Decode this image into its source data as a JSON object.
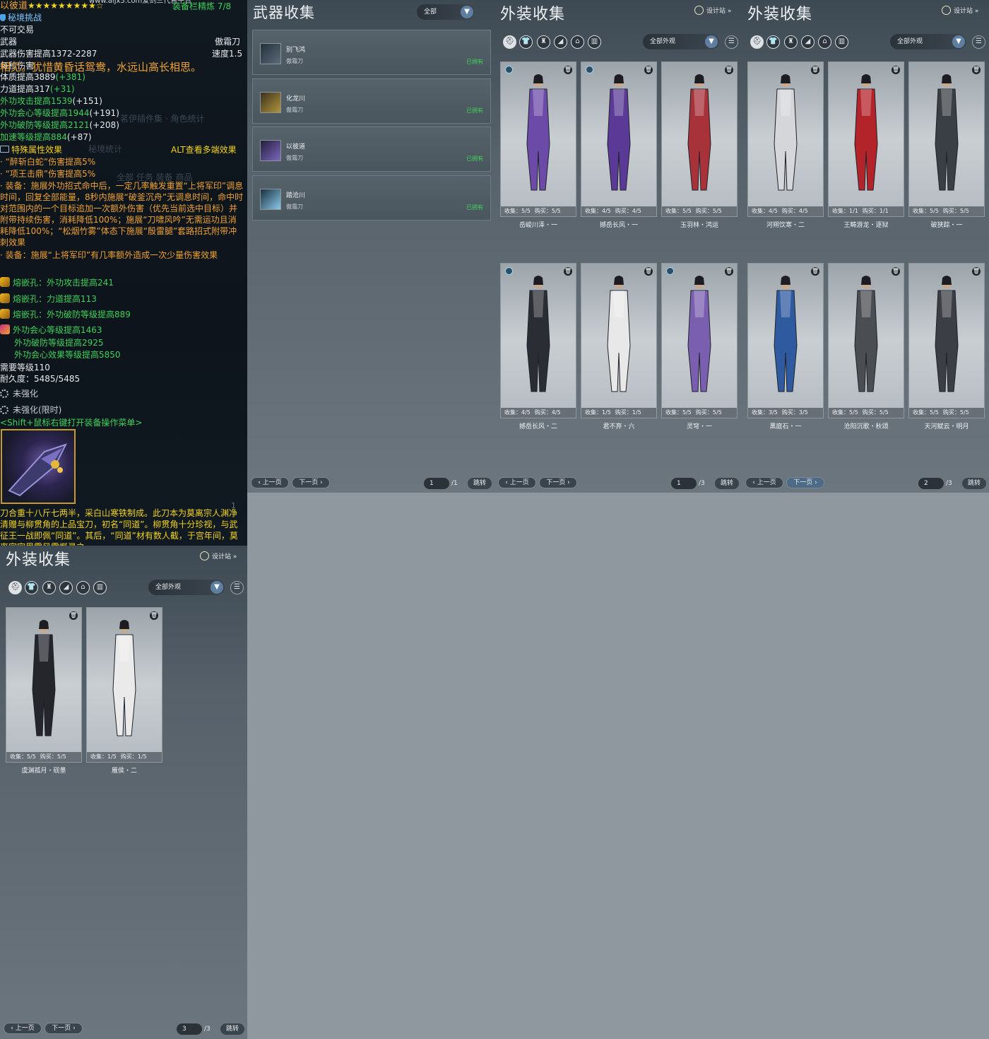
{
  "tooltip": {
    "name": "以彼道",
    "stars": "★★★★★★★★★☆",
    "refine": "装备栏精炼 7/8",
    "watermark": "www.aijx5.com爱剑三代售平台",
    "source": "秘境挑战",
    "trade": "不可交易",
    "slot": "武器",
    "type": "傲霜刀",
    "damage": "武器伤害提高1372-2287",
    "speed": "速度1.5",
    "overlay_poem": "相见。犹惜黄昏话鸳鸯，水远山高长相思。",
    "dps": "每秒伤害",
    "attr1": "体质提高3889",
    "attr1_bonus": "(+381)",
    "attr2": "力道提高317",
    "attr2_bonus": "(+31)",
    "attr3": "外功攻击提高1539",
    "attr3_bonus": "(+151)",
    "attr4": "外功会心等级提高1944",
    "attr4_bonus": "(+191)",
    "attr5": "外功破防等级提高2121",
    "attr5_bonus": "(+208)",
    "attr6": "加速等级提高884",
    "attr6_bonus": "(+87)",
    "bg_text1": "茗伊插件集 · 角色统计",
    "bg_text2": "秘境统计",
    "bg_text3": "全部    任务    装备    商品",
    "special_label": "特殊属性效果",
    "alt_hint": "ALT查看多端效果",
    "effect1": "· “醉斩白蛇”伤害提高5%",
    "effect2": "· “项王击鼎”伤害提高5%",
    "effect3": "· 装备：施展外功招式命中后，一定几率触发重置“上将军印”调息时间，回复全部能量，8秒内施展“破釜沉舟”无调息时间，命中时对范围内的一个目标追加一次额外伤害（优先当前选中目标）并附带持续伤害，消耗降低100%；施展“刀啸风吟”无需运功且消耗降低100%；“松烟竹雾”体态下施展“殷雷腿”套路招式附带冲刺效果",
    "effect4": "· 装备：施展“上将军印”有几率额外造成一次少量伤害效果",
    "gem1": "熔嵌孔：外功攻击提高241",
    "gem2": "熔嵌孔：力道提高113",
    "gem3": "熔嵌孔：外功破防等级提高889",
    "enchant1": "外功会心等级提高1463",
    "enchant2": "外功破防等级提高2925",
    "enchant3": "外功会心效果等级提高5850",
    "req_level": "需要等级110",
    "durability": "耐久度：5485/5485",
    "unenhanced1": "未强化",
    "unenhanced2": "未强化(限时)",
    "shift_hint": "<Shift+鼠标右键打开装备操作菜单>",
    "desc_count": "1",
    "desc": "刀合重十八斤七两半，采白山寒铁制成。此刀本为莫离宗人渊净清赠与柳贯角的上品宝刀，初名“同道”。柳贯角十分珍视，与武征王一战即佩“同道”。其后，“同道”材有数人截，于宫年间，莫离宗宗里雷风雷慨录之"
  },
  "weapon_panel": {
    "title": "武器收集",
    "filter": "全部",
    "items": [
      {
        "name": "别飞鸿",
        "sub": "傲霜刀",
        "owned": "已拥有"
      },
      {
        "name": "化龙川",
        "sub": "傲霜刀",
        "owned": "已拥有"
      },
      {
        "name": "以彼道",
        "sub": "傲霜刀",
        "owned": "已拥有"
      },
      {
        "name": "踏沧川",
        "sub": "傲霜刀",
        "owned": "已拥有"
      }
    ],
    "prev": "上一页",
    "next": "下一页",
    "page": "1",
    "total": "/1",
    "jump": "跳转"
  },
  "outfit_common": {
    "title": "外装收集",
    "designer": "设计站",
    "filter": "全部外观",
    "prev": "上一页",
    "next": "下一页",
    "jump": "跳转",
    "cat_icons": [
      "head-icon",
      "top-icon",
      "waist-icon",
      "cloak-icon",
      "hat-icon",
      "pants-icon"
    ]
  },
  "outfit_p1": {
    "page": "1",
    "total": "/3",
    "cards": [
      {
        "collect": "收集：5/5",
        "buy": "购买：5/5",
        "name": "岳峻川泽・一",
        "badge": true,
        "color": "#6c4aa8"
      },
      {
        "collect": "收集：4/5",
        "buy": "购买：4/5",
        "name": "撼岳长风・一",
        "badge": true,
        "color": "#5a3a96"
      },
      {
        "collect": "收集：5/5",
        "buy": "购买：5/5",
        "name": "玉羽林・鸿运",
        "badge": false,
        "color": "#a8323a"
      },
      {
        "collect": "收集：4/5",
        "buy": "购买：4/5",
        "name": "撼岳长风・二",
        "badge": true,
        "color": "#2a2d34"
      },
      {
        "collect": "收集：1/5",
        "buy": "购买：1/5",
        "name": "君不弃・六",
        "badge": false,
        "color": "#e8e8e8"
      },
      {
        "collect": "收集：5/5",
        "buy": "购买：5/5",
        "name": "灵穹・一",
        "badge": true,
        "color": "#7a5fb0"
      }
    ]
  },
  "outfit_p2": {
    "page": "2",
    "total": "/3",
    "cards": [
      {
        "collect": "收集：4/5",
        "buy": "购买：4/5",
        "name": "河朔饮寒・二",
        "badge": false,
        "color": "#d4d6da"
      },
      {
        "collect": "收集：1/1",
        "buy": "购买：1/1",
        "name": "王畴游龙・逐狱",
        "badge": false,
        "color": "#b3232a"
      },
      {
        "collect": "收集：5/5",
        "buy": "购买：5/5",
        "name": "破狭踪・一",
        "badge": false,
        "color": "#3a3f46"
      },
      {
        "collect": "收集：3/5",
        "buy": "购买：3/5",
        "name": "黑庭石・一",
        "badge": false,
        "color": "#2f5aa0"
      },
      {
        "collect": "收集：5/5",
        "buy": "购买：5/5",
        "name": "沧阳沉歌・秋颂",
        "badge": false,
        "color": "#4a4d52"
      },
      {
        "collect": "收集：5/5",
        "buy": "购买：5/5",
        "name": "天河赋云・明月",
        "badge": false,
        "color": "#3b3e44"
      }
    ]
  },
  "outfit_p3": {
    "page": "3",
    "total": "/3",
    "cards": [
      {
        "collect": "收集：5/5",
        "buy": "购买：5/5",
        "name": "虞渊孤月・砚墨",
        "badge": false,
        "color": "#24262c"
      },
      {
        "collect": "收集：1/5",
        "buy": "购买：1/5",
        "name": "雁侯・二",
        "badge": false,
        "color": "#eaeaea"
      }
    ]
  }
}
